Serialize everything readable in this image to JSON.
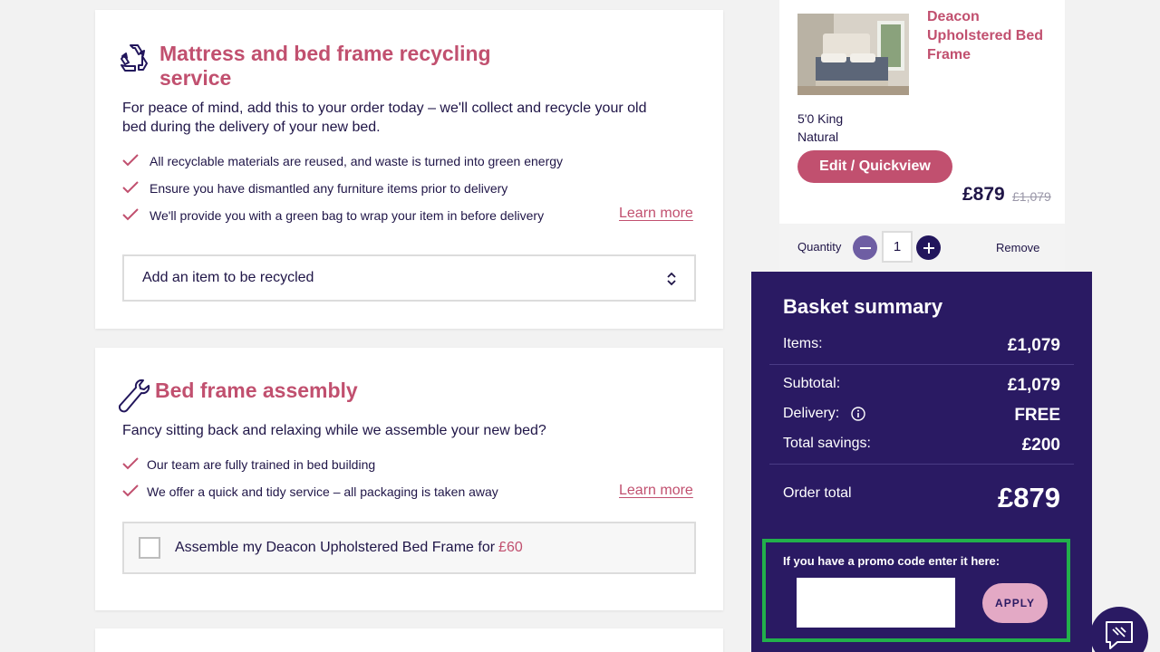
{
  "recycle": {
    "title_line1": "Mattress and bed frame recycling",
    "title_line2": "service",
    "desc_line1": "For peace of mind, add this to your order today – we'll collect and recycle your old",
    "desc_line2": "bed during the delivery of your new bed.",
    "bullets": [
      "All recyclable materials are reused, and waste is turned into green energy",
      "Ensure you have dismantled any furniture items prior to delivery",
      "We'll provide you with a green bag to wrap your item in before delivery"
    ],
    "learn_more": "Learn more",
    "select_placeholder": "Add an item to be recycled"
  },
  "assembly": {
    "title": "Bed frame assembly",
    "desc": "Fancy sitting back and relaxing while we assemble your new bed?",
    "bullets": [
      "Our team are fully trained in bed building",
      "We offer a quick and tidy service – all packaging is taken away"
    ],
    "learn_more": "Learn more",
    "checkbox_label": "Assemble my Deacon Upholstered Bed Frame for",
    "checkbox_price": "£60"
  },
  "product": {
    "name_line1": "Deacon",
    "name_line2": "Upholstered Bed",
    "name_line3": "Frame",
    "size": "5'0 King",
    "colour": "Natural",
    "edit_label": "Edit / Quickview",
    "price": "£879",
    "was_price": "£1,079",
    "quantity_label": "Quantity",
    "quantity": "1",
    "remove_label": "Remove"
  },
  "summary": {
    "title": "Basket summary",
    "items_label": "Items:",
    "items_value": "£1,079",
    "subtotal_label": "Subtotal:",
    "subtotal_value": "£1,079",
    "delivery_label": "Delivery:",
    "delivery_value": "FREE",
    "savings_label": "Total savings:",
    "savings_value": "£200",
    "total_label": "Order total",
    "total_value": "£879",
    "promo_label": "If you have a promo code enter it here:",
    "promo_value": "",
    "apply_label": "APPLY"
  },
  "colors": {
    "accent_pink": "#c1506f",
    "navy": "#2a1a63",
    "promo_highlight": "#22b04b"
  },
  "icons": [
    "recycle-icon",
    "wrench-icon",
    "check-icon",
    "chevron-updown-icon",
    "minus-icon",
    "plus-icon",
    "info-icon",
    "chat-icon"
  ]
}
